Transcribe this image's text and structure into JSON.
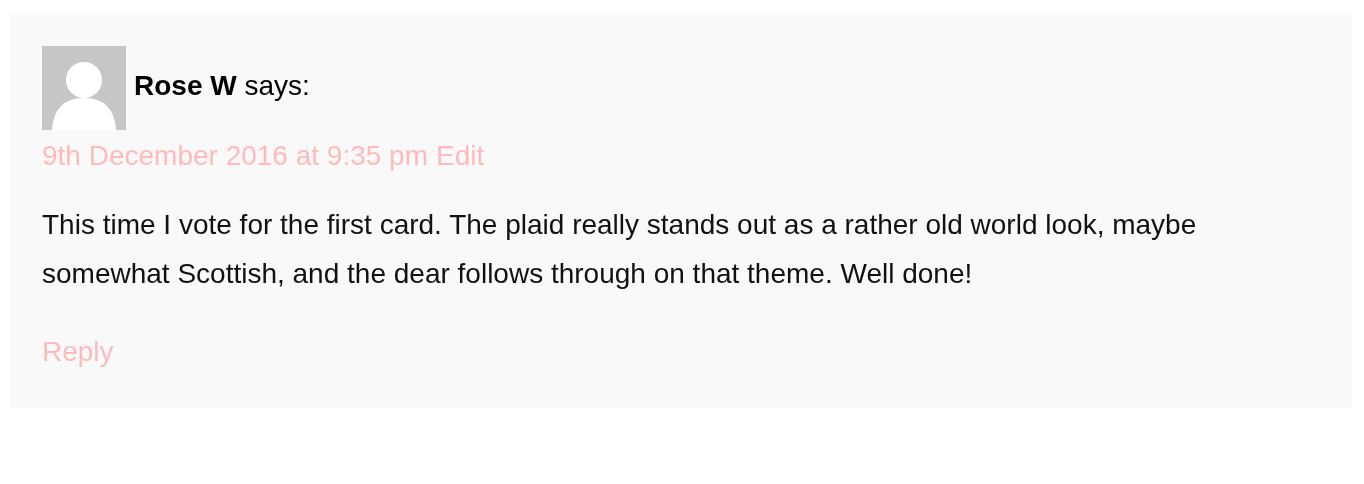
{
  "comment": {
    "author": "Rose W",
    "says": "says:",
    "date": "9th December 2016 at 9:35 pm",
    "edit": "Edit",
    "text": "This time I vote for the first card. The plaid really stands out as a rather old world look, maybe somewhat Scottish, and the dear follows through on that theme. Well done!",
    "reply": "Reply"
  }
}
